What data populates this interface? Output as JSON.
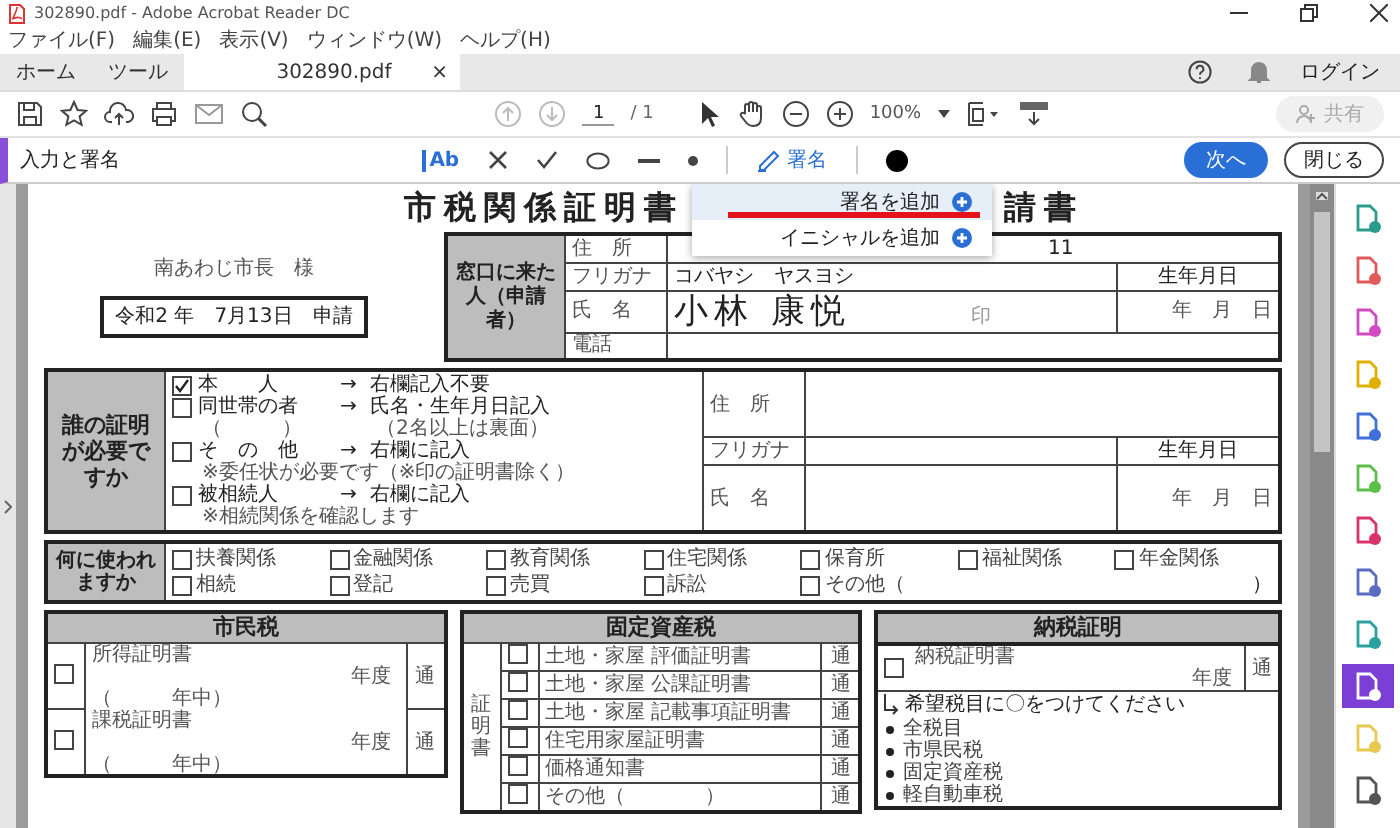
{
  "window": {
    "title": "302890.pdf - Adobe Acrobat Reader DC"
  },
  "menu": [
    {
      "label": "ファイル(F)"
    },
    {
      "label": "編集(E)"
    },
    {
      "label": "表示(V)"
    },
    {
      "label": "ウィンドウ(W)"
    },
    {
      "label": "ヘルプ(H)"
    }
  ],
  "tabs": [
    {
      "label": "ホーム",
      "selected": false
    },
    {
      "label": "ツール",
      "selected": false
    },
    {
      "label": "302890.pdf",
      "selected": true,
      "close": "×"
    }
  ],
  "account": {
    "label": "ログイン"
  },
  "toolbar": {
    "prev_page_disabled": true,
    "next_page_disabled": true,
    "page": "1",
    "page_count": "/ 1",
    "zoom": "100%",
    "share": {
      "label": "共有",
      "disabled": true
    }
  },
  "sign_bar": {
    "title": "入力と署名",
    "text_tool": "Ab",
    "sign": "署名",
    "next": "次へ",
    "close": "閉じる"
  },
  "sign_menu": [
    {
      "label": "署名を追加",
      "selected": true,
      "marked": true
    },
    {
      "label": "イニシャルを追加",
      "selected": false,
      "marked": false
    }
  ],
  "document": {
    "title_left": "市税関係証明書",
    "title_right": "請書",
    "addressee": "南あわじ市長　様",
    "date": "令和2 年　7月13日　申請",
    "applicant": {
      "heading": "窓口に来た人（申請者）",
      "address_label": "住　所",
      "address": "11",
      "furigana_label": "フリガナ",
      "furigana": "コバヤシ　ヤスヨシ",
      "birth_label": "生年月日",
      "name_label": "氏　名",
      "name": "小林 康悦",
      "seal": "印",
      "birth_date": "年　月　日",
      "phone_label": "電話"
    },
    "who": {
      "heading": "誰の証明が必要ですか",
      "options": [
        {
          "checked": true,
          "label": "本　　人",
          "arrow": "→",
          "instruction": "右欄記入不要"
        },
        {
          "checked": false,
          "label": "同世帯の者",
          "paren": "（　　　）",
          "arrow": "→",
          "instruction": "氏名・生年月日記入",
          "note": "（2名以上は裏面）"
        },
        {
          "checked": false,
          "label": "そ　の　他",
          "arrow": "→",
          "instruction": "右欄に記入",
          "note": "※委任状が必要です（※印の証明書除く）"
        },
        {
          "checked": false,
          "label": "被相続人",
          "arrow": "→",
          "instruction": "右欄に記入",
          "note": "※相続関係を確認します"
        }
      ],
      "address_label": "住　所",
      "furigana_label": "フリガナ",
      "birth_label": "生年月日",
      "name_label": "氏　名",
      "birth_date": "年　月　日"
    },
    "usage": {
      "heading": "何に使われますか",
      "items": [
        {
          "label": "扶養関係",
          "checked": false
        },
        {
          "label": "金融関係",
          "checked": false
        },
        {
          "label": "教育関係",
          "checked": false
        },
        {
          "label": "住宅関係",
          "checked": false
        },
        {
          "label": "保育所",
          "checked": false
        },
        {
          "label": "福祉関係",
          "checked": false
        },
        {
          "label": "年金関係",
          "checked": false
        },
        {
          "label": "相続",
          "checked": false
        },
        {
          "label": "登記",
          "checked": false
        },
        {
          "label": "売買",
          "checked": false
        },
        {
          "label": "訴訟",
          "checked": false
        },
        {
          "label": "その他（",
          "checked": false
        }
      ],
      "close_paren": "）"
    },
    "resident_tax": {
      "heading": "市民税",
      "rows": [
        {
          "checked": false,
          "name": "所得証明書",
          "year": "年度",
          "period": "（　　　年中）",
          "unit": "通"
        },
        {
          "checked": false,
          "name": "課税証明書",
          "year": "年度",
          "period": "（　　　年中）",
          "unit": "通"
        }
      ]
    },
    "property_tax": {
      "heading": "固定資産税",
      "side": "証明書",
      "rows": [
        {
          "checked": false,
          "prefix": "土地・家屋",
          "name": "評価証明書",
          "unit": "通"
        },
        {
          "checked": false,
          "prefix": "土地・家屋",
          "name": "公課証明書",
          "unit": "通"
        },
        {
          "checked": false,
          "prefix": "土地・家屋",
          "name": "記載事項証明書",
          "unit": "通"
        },
        {
          "checked": false,
          "name": "住宅用家屋証明書",
          "unit": "通"
        },
        {
          "checked": false,
          "name": "価格通知書",
          "unit": "通"
        },
        {
          "checked": false,
          "name": "その他（　　　　）",
          "unit": "通"
        }
      ]
    },
    "payment": {
      "heading": "納税証明",
      "row": {
        "checked": false,
        "name": "納税証明書",
        "year": "年度",
        "unit": "通"
      },
      "note": "希望税目に〇をつけてください",
      "items": [
        "全税目",
        "市県民税",
        "固定資産税",
        "軽自動車税"
      ]
    }
  },
  "tools_panel": [
    {
      "color": "#2b9c8c",
      "selected": false
    },
    {
      "color": "#e05a5a",
      "selected": false
    },
    {
      "color": "#d04ac0",
      "selected": false
    },
    {
      "color": "#e0b000",
      "selected": false
    },
    {
      "color": "#3f6fd8",
      "selected": false
    },
    {
      "color": "#5cbf4a",
      "selected": false
    },
    {
      "color": "#d8346a",
      "selected": false
    },
    {
      "color": "#5a6cc0",
      "selected": false
    },
    {
      "color": "#2aa0a0",
      "selected": false
    },
    {
      "color": "#7b3fd6",
      "selected": true
    },
    {
      "color": "#e8c850",
      "selected": false
    },
    {
      "color": "#555555",
      "selected": false
    }
  ]
}
